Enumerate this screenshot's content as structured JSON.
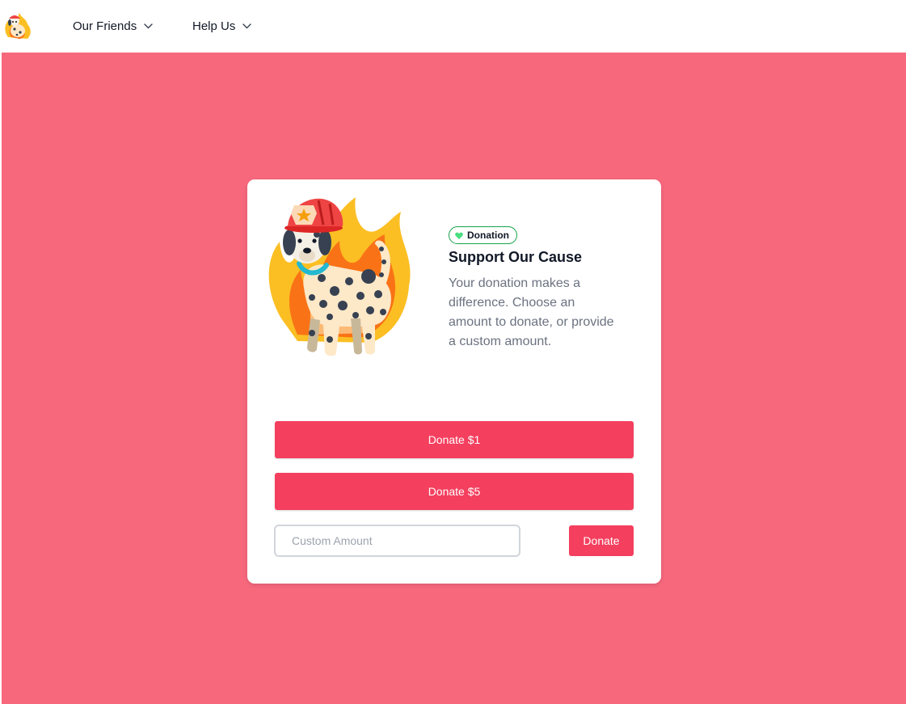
{
  "header": {
    "logo_icon": "dalmatian-firefighter-logo",
    "nav": [
      {
        "label": "Our Friends",
        "icon": "chevron-down-icon"
      },
      {
        "label": "Help Us",
        "icon": "chevron-down-icon"
      }
    ]
  },
  "donation_card": {
    "image_icon": "dalmatian-firefighter-illustration",
    "badge": {
      "label": "Donation",
      "icon": "heart-icon",
      "color": "#16a34a"
    },
    "title": "Support Our Cause",
    "description": "Your donation makes a difference. Choose an amount to donate, or provide a custom amount.",
    "buttons": [
      {
        "label": "Donate $1"
      },
      {
        "label": "Donate $5"
      }
    ],
    "custom_amount": {
      "placeholder": "Custom Amount",
      "value": ""
    },
    "submit_label": "Donate"
  },
  "colors": {
    "background": "#f7687d",
    "accent": "#f43f5e",
    "text": "#111827",
    "muted_text": "#6b7280"
  }
}
